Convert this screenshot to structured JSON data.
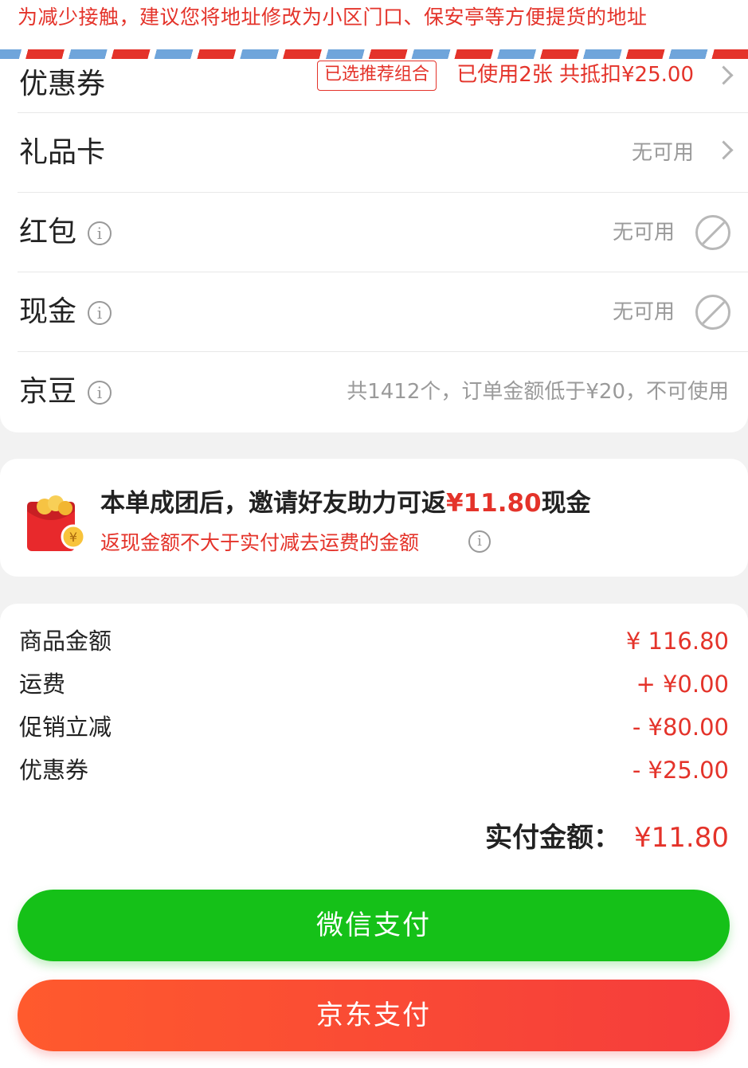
{
  "notice": {
    "text": "为减少接触，建议您将地址修改为小区门口、保安亭等方便提货的地址"
  },
  "rows": {
    "coupon": {
      "label": "优惠券",
      "badge": "已选推荐组合",
      "value": "已使用2张 共抵扣¥25.00"
    },
    "gift_card": {
      "label": "礼品卡",
      "value": "无可用"
    },
    "red_packet": {
      "label": "红包",
      "value": "无可用"
    },
    "cash": {
      "label": "现金",
      "value": "无可用"
    },
    "jd_beans": {
      "label": "京豆",
      "value": "共1412个，订单金额低于¥20，不可使用"
    }
  },
  "cashback": {
    "prefix": "本单成团后，邀请好友助力可返",
    "amount": "¥11.80",
    "suffix": "现金",
    "note": "返现金额不大于实付减去运费的金额"
  },
  "summary": [
    {
      "label": "商品金额",
      "value": "¥ 116.80"
    },
    {
      "label": "运费",
      "value": "+ ¥0.00"
    },
    {
      "label": "促销立减",
      "value": "- ¥80.00"
    },
    {
      "label": "优惠券",
      "value": "- ¥25.00"
    }
  ],
  "total": {
    "label": "实付金额：",
    "value": "¥11.80"
  },
  "buttons": {
    "wechat_pay": "微信支付",
    "jd_pay": "京东支付"
  },
  "colors": {
    "accent_red": "#e4332a",
    "wechat_green": "#15c118",
    "jd_gradient_start": "#ff5a2d",
    "jd_gradient_end": "#f53c3c"
  }
}
